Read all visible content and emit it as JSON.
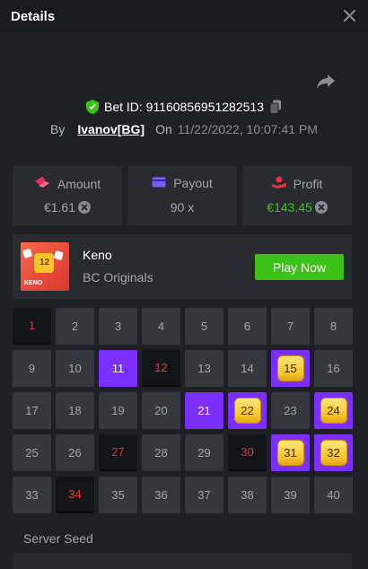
{
  "header": {
    "title": "Details"
  },
  "bet": {
    "id_text": "Bet ID: 91160856951282513",
    "by_label": "By",
    "user": "Ivanov[BG]",
    "on_label": "On",
    "date": "11/22/2022, 10:07:41 PM"
  },
  "stats": {
    "amount_label": "Amount",
    "amount_value": "€1.61",
    "payout_label": "Payout",
    "payout_value": "90 x",
    "profit_label": "Profit",
    "profit_value": "€143.45"
  },
  "game": {
    "thumb_label": "KENO",
    "thumb_number": "12",
    "name": "Keno",
    "provider": "BC Originals",
    "play_label": "Play Now"
  },
  "keno": {
    "numbers": [
      "1",
      "2",
      "3",
      "4",
      "5",
      "6",
      "7",
      "8",
      "9",
      "10",
      "11",
      "12",
      "13",
      "14",
      "15",
      "16",
      "17",
      "18",
      "19",
      "20",
      "21",
      "22",
      "23",
      "24",
      "25",
      "26",
      "27",
      "28",
      "29",
      "30",
      "31",
      "32",
      "33",
      "34",
      "35",
      "36",
      "37",
      "38",
      "39",
      "40"
    ],
    "selected": [
      11,
      21
    ],
    "hits": [
      15,
      22,
      24,
      31,
      32
    ],
    "drawn": [
      1,
      12,
      27,
      30,
      34
    ]
  },
  "server_seed": {
    "label": "Server Seed"
  },
  "colors": {
    "accent": "#3bc117",
    "selected": "#7b2fff",
    "drawn_text": "#e8303a",
    "gem": "#f6c52a"
  }
}
